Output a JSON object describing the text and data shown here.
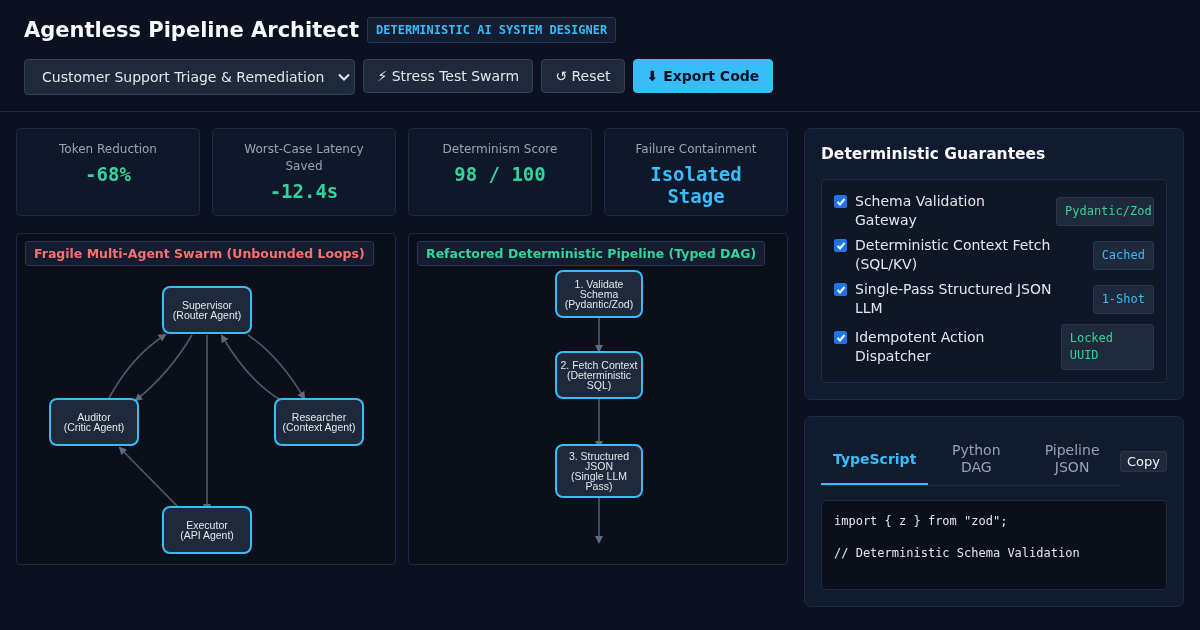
{
  "header": {
    "title": "Agentless Pipeline Architect",
    "badge": "DETERMINISTIC AI SYSTEM DESIGNER"
  },
  "toolbar": {
    "scenario_select": {
      "value": "Customer Support Triage & Remediation"
    },
    "buttons": [
      {
        "label": "⚡ Stress Test Swarm",
        "kind": "secondary"
      },
      {
        "label": "↺ Reset",
        "kind": "secondary"
      },
      {
        "label": "⬇ Export Code",
        "kind": "primary"
      }
    ]
  },
  "stats": [
    {
      "label": "Token Reduction",
      "value": "-68%",
      "color": "#34d399"
    },
    {
      "label": "Worst-Case Latency Saved",
      "value": "-12.4s",
      "color": "#34d399"
    },
    {
      "label": "Determinism Score",
      "value": "98 / 100",
      "color": "#34d399"
    },
    {
      "label": "Failure Containment",
      "value": "Isolated Stage",
      "color": "#38bdf8"
    }
  ],
  "diagrams": [
    {
      "title": "Fragile Multi-Agent Swarm (Unbounded Loops)",
      "kind": "swarm",
      "nodes": [
        {
          "lines": [
            "Supervisor",
            "(Router Agent)"
          ]
        },
        {
          "lines": [
            "Auditor",
            "(Critic Agent)"
          ]
        },
        {
          "lines": [
            "Researcher",
            "(Context Agent)"
          ]
        },
        {
          "lines": [
            "Executor",
            "(API Agent)"
          ]
        }
      ]
    },
    {
      "title": "Refactored Deterministic Pipeline (Typed DAG)",
      "kind": "pipeline",
      "nodes": [
        {
          "lines": [
            "1. Validate",
            "Schema",
            "(Pydantic/Zod)"
          ]
        },
        {
          "lines": [
            "2. Fetch Context",
            "(Deterministic",
            "SQL)"
          ]
        },
        {
          "lines": [
            "3. Structured",
            "JSON",
            "(Single LLM",
            "Pass)"
          ]
        }
      ]
    }
  ],
  "guarantees": {
    "title": "Deterministic Guarantees",
    "items": [
      {
        "label": "Schema Validation Gateway",
        "checked": true,
        "tag": "Pydantic/Zod",
        "color": "#34d399"
      },
      {
        "label": "Deterministic Context Fetch (SQL/KV)",
        "checked": true,
        "tag": "Cached",
        "color": "#38bdf8"
      },
      {
        "label": "Single-Pass Structured JSON LLM",
        "checked": true,
        "tag": "1-Shot",
        "color": "#38bdf8"
      },
      {
        "label": "Idempotent Action Dispatcher",
        "checked": true,
        "tag": "Locked UUID",
        "color": "#34d399"
      }
    ]
  },
  "code_panel": {
    "tabs": [
      {
        "label": "TypeScript",
        "selected": true
      },
      {
        "label": "Python DAG",
        "selected": false
      },
      {
        "label": "Pipeline JSON",
        "selected": false
      }
    ],
    "copy_button": "Copy",
    "code_lines": [
      "import { z } from \"zod\";",
      "// Deterministic Schema Validation"
    ]
  }
}
